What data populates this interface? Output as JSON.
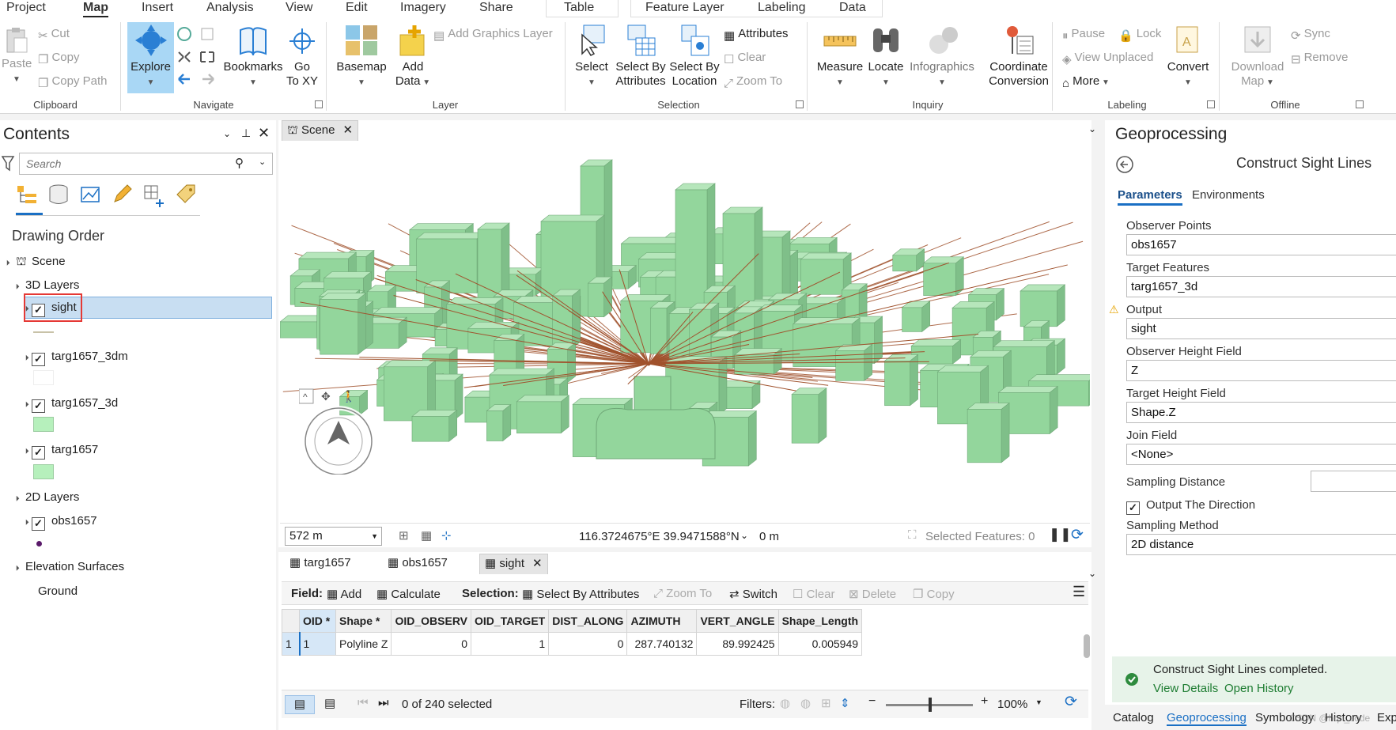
{
  "ribbon_tabs": [
    "Project",
    "Map",
    "Insert",
    "Analysis",
    "View",
    "Edit",
    "Imagery",
    "Share"
  ],
  "context_tabs": [
    "Table",
    "Feature Layer",
    "Labeling",
    "Data"
  ],
  "clipboard": {
    "paste": "Paste",
    "cut": "Cut",
    "copy": "Copy",
    "copy_path": "Copy Path",
    "group": "Clipboard"
  },
  "navigate": {
    "explore": "Explore",
    "bookmarks": "Bookmarks",
    "goto_l1": "Go",
    "goto_l2": "To XY",
    "group": "Navigate"
  },
  "layer": {
    "basemap": "Basemap",
    "add_data_l1": "Add",
    "add_data_l2": "Data",
    "add_graphics": "Add Graphics Layer",
    "group": "Layer"
  },
  "selection": {
    "select": "Select",
    "sba_l1": "Select By",
    "sba_l2": "Attributes",
    "sbl_l1": "Select By",
    "sbl_l2": "Location",
    "attributes": "Attributes",
    "clear": "Clear",
    "zoom_to": "Zoom To",
    "group": "Selection"
  },
  "inquiry": {
    "measure": "Measure",
    "locate": "Locate",
    "infographics": "Infographics",
    "coord_l1": "Coordinate",
    "coord_l2": "Conversion",
    "group": "Inquiry"
  },
  "labeling": {
    "pause": "Pause",
    "lock": "Lock",
    "view_unplaced": "View Unplaced",
    "more": "More",
    "convert": "Convert",
    "group": "Labeling"
  },
  "offline": {
    "download_l1": "Download",
    "download_l2": "Map",
    "sync": "Sync",
    "remove": "Remove",
    "group": "Offline"
  },
  "contents": {
    "title": "Contents",
    "search_placeholder": "Search",
    "drawing_order": "Drawing Order",
    "scene": "Scene",
    "layers_3d": "3D Layers",
    "layers_2d": "2D Layers",
    "elevation": "Elevation Surfaces",
    "ground": "Ground",
    "items": [
      {
        "name": "sight",
        "checked": true
      },
      {
        "name": "targ1657_3dm",
        "checked": true
      },
      {
        "name": "targ1657_3d",
        "checked": true
      },
      {
        "name": "targ1657",
        "checked": true
      },
      {
        "name": "obs1657",
        "checked": true
      }
    ]
  },
  "map": {
    "tab": "Scene",
    "scale": "572 m",
    "coords": "116.3724675°E 39.9471588°N",
    "elevation": "0 m",
    "selected": "Selected Features: 0"
  },
  "table": {
    "tabs": [
      "targ1657",
      "obs1657",
      "sight"
    ],
    "toolbar": {
      "field": "Field:",
      "add": "Add",
      "calculate": "Calculate",
      "selection": "Selection:",
      "sba": "Select By Attributes",
      "zoom_to": "Zoom To",
      "switch": "Switch",
      "clear": "Clear",
      "delete": "Delete",
      "copy": "Copy"
    },
    "columns": [
      "OID *",
      "Shape *",
      "OID_OBSERV",
      "OID_TARGET",
      "DIST_ALONG",
      "AZIMUTH",
      "VERT_ANGLE",
      "Shape_Length"
    ],
    "rows": [
      [
        "1",
        "Polyline Z",
        "0",
        "1",
        "0",
        "287.740132",
        "89.992425",
        "0.005949"
      ]
    ],
    "row_number": "1",
    "selected_count": "0 of 240 selected",
    "filters": "Filters:",
    "zoom": "100%"
  },
  "geoprocessing": {
    "title": "Geoprocessing",
    "tool": "Construct Sight Lines",
    "tab_params": "Parameters",
    "tab_env": "Environments",
    "observer_label": "Observer Points",
    "observer_value": "obs1657",
    "target_label": "Target Features",
    "target_value": "targ1657_3d",
    "output_label": "Output",
    "output_value": "sight",
    "obs_height_label": "Observer Height Field",
    "obs_height_value": "Z",
    "tgt_height_label": "Target Height Field",
    "tgt_height_value": "Shape.Z",
    "join_label": "Join Field",
    "join_value": "<None>",
    "sampling_label": "Sampling Distance",
    "direction_label": "Output The Direction",
    "method_label": "Sampling Method",
    "method_value": "2D distance",
    "success": "Construct Sight Lines completed.",
    "view_details": "View Details",
    "open_history": "Open History"
  },
  "bottom_tabs": [
    "Catalog",
    "Geoprocessing",
    "Symbology",
    "History",
    "Exp"
  ],
  "watermark": "CSDN @hqn_code",
  "colors": {
    "building": "#93d69c",
    "sightline": "#a0522d",
    "accent": "#1a6fc4",
    "explore_bg": "#a9d7f5"
  }
}
